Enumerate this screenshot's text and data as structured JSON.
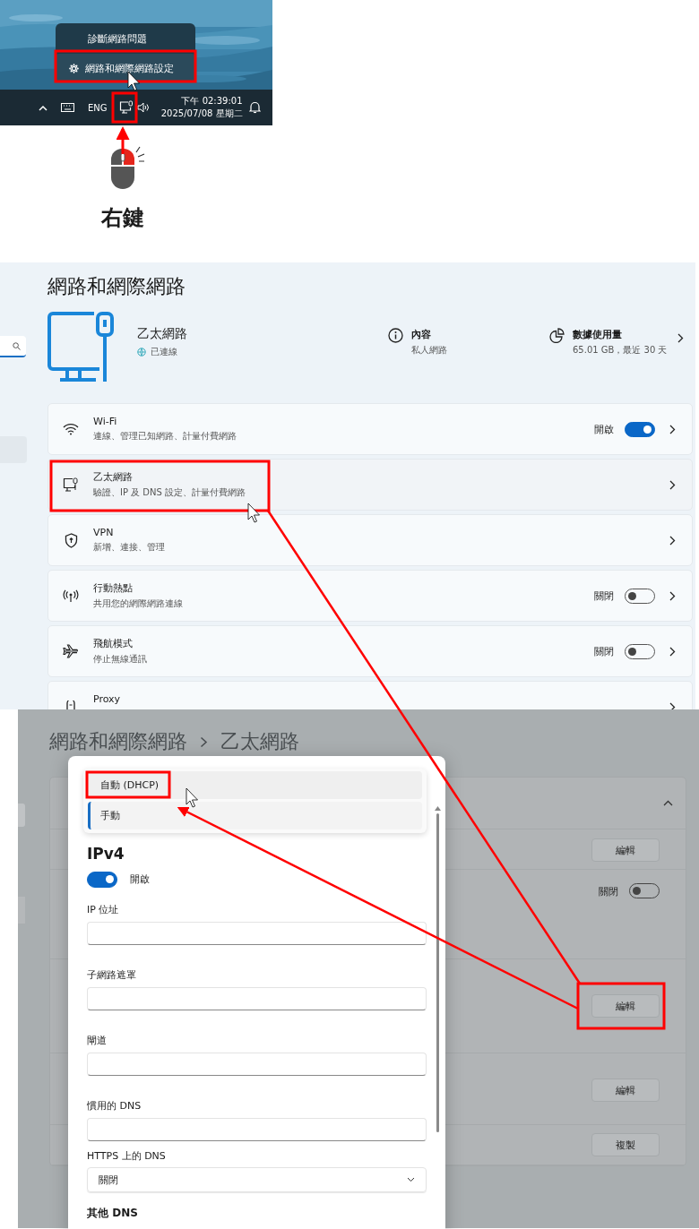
{
  "taskbar": {
    "menu": [
      {
        "kind": "plain",
        "label": "診斷網路問題",
        "highlighted": false
      },
      {
        "kind": "settings",
        "label": "網路和網際網路設定",
        "highlighted": true
      }
    ],
    "language": "ENG",
    "time": "下午 02:39:01",
    "date": "2025/07/08 星期二",
    "network_highlighted": true
  },
  "mouse_caption": "右鍵",
  "settings": {
    "title": "網路和網際網路",
    "connection": {
      "name": "乙太網路",
      "status": "已連線"
    },
    "properties": {
      "title": "內容",
      "value": "私人網路"
    },
    "data_usage": {
      "title": "數據使用量",
      "value": "65.01 GB，最近 30 天"
    },
    "items": [
      {
        "kind": "wifi",
        "title": "Wi-Fi",
        "subtitle": "連線、管理已知網路、計量付費網路",
        "toggle": {
          "label": "開啟",
          "on": true
        },
        "highlighted": false
      },
      {
        "kind": "ethernet",
        "title": "乙太網路",
        "subtitle": "驗證、IP 及 DNS 設定、計量付費網路",
        "highlighted": true
      },
      {
        "kind": "vpn",
        "title": "VPN",
        "subtitle": "新增、連接、管理",
        "highlighted": false
      },
      {
        "kind": "hotspot",
        "title": "行動熱點",
        "subtitle": "共用您的網際網路連線",
        "toggle": {
          "label": "關閉",
          "on": false
        },
        "highlighted": false
      },
      {
        "kind": "airplane",
        "title": "飛航模式",
        "subtitle": "停止無線通訊",
        "toggle": {
          "label": "關閉",
          "on": false
        },
        "highlighted": false
      },
      {
        "kind": "proxy",
        "title": "Proxy",
        "highlighted": false
      }
    ]
  },
  "ethernet_page": {
    "breadcrumb": [
      "網路和網際網路",
      "乙太網路"
    ],
    "rows": [
      {
        "kind": "button",
        "label": "編輯",
        "highlighted": false
      },
      {
        "kind": "toggle",
        "label": "關閉",
        "on": false
      },
      {
        "kind": "button",
        "label": "編輯",
        "highlighted": true
      },
      {
        "kind": "button",
        "label": "編輯",
        "highlighted": false
      },
      {
        "kind": "button",
        "label": "複製",
        "highlighted": false
      }
    ]
  },
  "dialog": {
    "mode_options": [
      {
        "label": "自動 (DHCP)",
        "selected": false,
        "highlighted": true
      },
      {
        "label": "手動",
        "selected": true,
        "highlighted": false
      }
    ],
    "section": "IPv4",
    "ipv4_toggle": {
      "label": "開啟",
      "on": true
    },
    "fields": [
      {
        "label": "IP 位址"
      },
      {
        "label": "子網路遮罩"
      },
      {
        "label": "閘道"
      },
      {
        "label": "慣用的 DNS"
      }
    ],
    "https_dns": {
      "label": "HTTPS 上的 DNS",
      "value": "關閉"
    },
    "more_label": "其他 DNS"
  }
}
